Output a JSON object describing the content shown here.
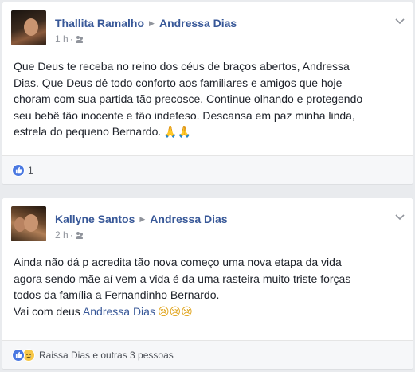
{
  "posts": [
    {
      "author": "Thallita Ramalho",
      "target": "Andressa Dias",
      "time": "1 h",
      "privacy_icon": "friends-icon",
      "text_lines": [
        "Que Deus te receba no reino dos céus de braços abertos, Andressa",
        "Dias. Que Deus dê todo conforto aos familiares e amigos que hoje",
        "choram com sua partida tão precosce. Continue olhando e protegendo",
        "seu bebê tão inocente e tão indefeso. Descansa em paz minha linda,",
        "estrela do pequeno Bernardo."
      ],
      "trailing_emoji": "🙏🙏",
      "reactions": {
        "icons": [
          "like-icon"
        ],
        "count": "1"
      }
    },
    {
      "author": "Kallyne Santos",
      "target": "Andressa Dias",
      "time": "2 h",
      "privacy_icon": "friends-icon",
      "text_lines": [
        "Ainda não dá p acredita tão nova começo uma nova etapa da vida",
        "agora sendo mãe aí vem a vida é da uma rasteira muito triste forças",
        "todos da família a Fernandinho Bernardo."
      ],
      "last_line_prefix": "Vai com deus ",
      "last_line_mention": "Andressa Dias",
      "trailing_emoji": "😢😢😢",
      "reactions": {
        "icons": [
          "like-icon",
          "sad-icon"
        ],
        "names": "Raissa Dias e outras 3 pessoas"
      }
    }
  ],
  "colors": {
    "link": "#385898",
    "page_bg": "#e9ebee",
    "like_blue": "#4a78e1"
  }
}
